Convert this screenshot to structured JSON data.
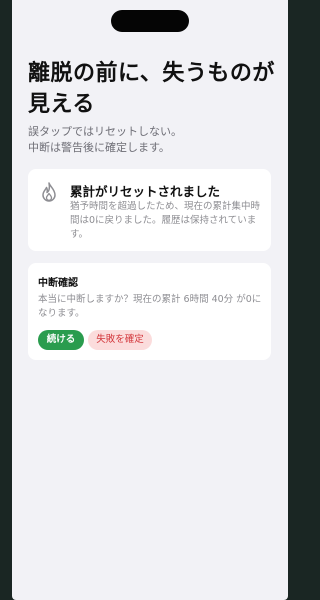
{
  "header": {
    "title": "離脱の前に、失うものが見える",
    "subtitle_line1": "誤タップではリセットしない。",
    "subtitle_line2": "中断は警告後に確定します。"
  },
  "reset_card": {
    "icon": "flame-icon",
    "title": "累計がリセットされました",
    "description": "猶予時間を超過したため、現在の累計集中時間は0に戻りました。履歴は保持されています。"
  },
  "confirm_card": {
    "title": "中断確認",
    "description": "本当に中断しますか？現在の累計 6時間 40分 が0になります。",
    "continue_label": "続ける",
    "fail_label": "失敗を確定"
  },
  "colors": {
    "accent_green": "#2a9c4e",
    "danger_red": "#d3383d",
    "danger_bg": "#fbdcdc",
    "background": "#f2f2f6"
  }
}
